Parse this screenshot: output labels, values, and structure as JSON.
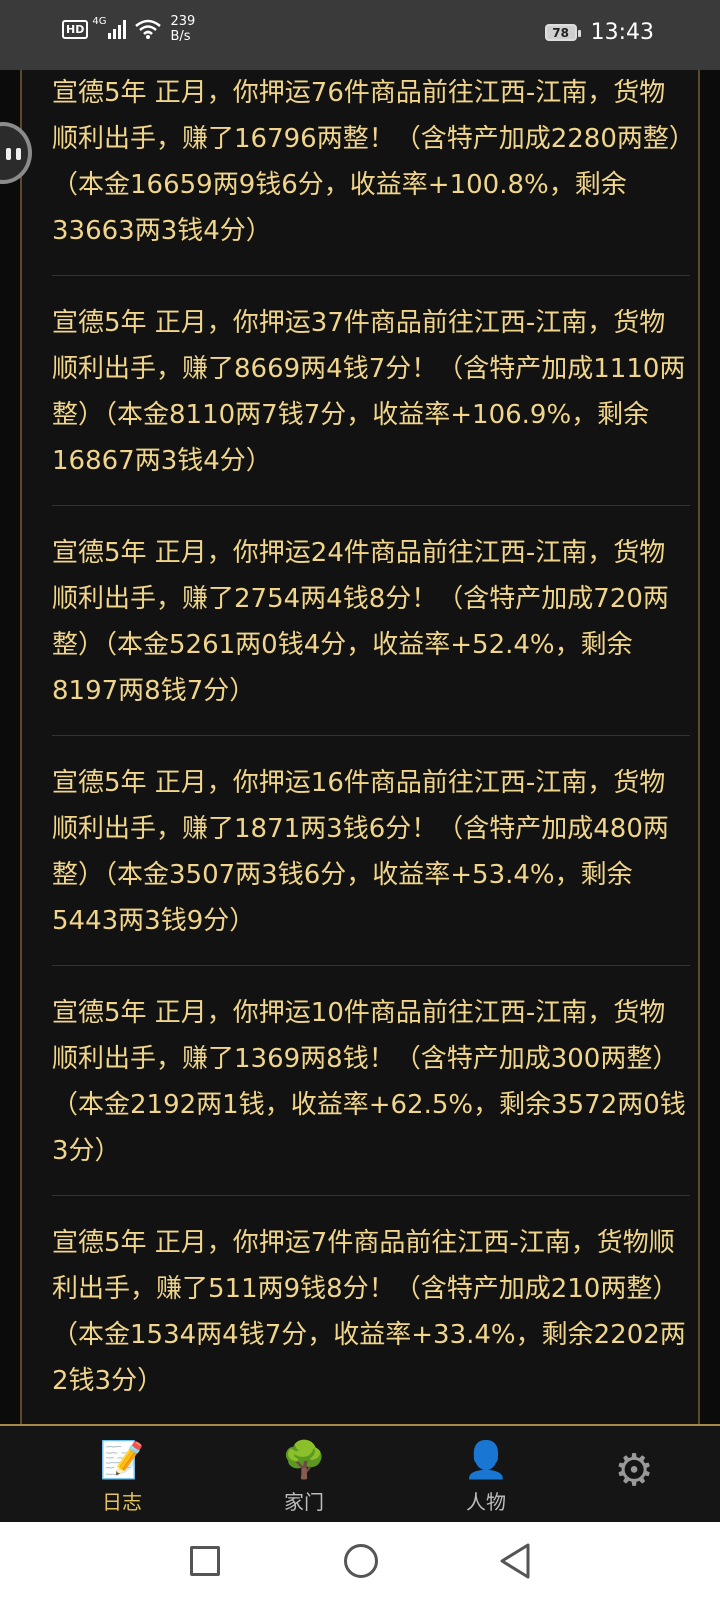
{
  "status_bar": {
    "hd": "HD",
    "network": "4G",
    "speed_value": "239",
    "speed_unit": "B/s",
    "battery": "78",
    "time": "13:43"
  },
  "log_entries": [
    "宣德5年 正月，你押运76件商品前往江西-江南，货物顺利出手，赚了16796两整！（含特产加成2280两整）（本金16659两9钱6分，收益率+100.8%，剩余33663两3钱4分）",
    "宣德5年 正月，你押运37件商品前往江西-江南，货物顺利出手，赚了8669两4钱7分！（含特产加成1110两整）（本金8110两7钱7分，收益率+106.9%，剩余16867两3钱4分）",
    "宣德5年 正月，你押运24件商品前往江西-江南，货物顺利出手，赚了2754两4钱8分！（含特产加成720两整）（本金5261两0钱4分，收益率+52.4%，剩余8197两8钱7分）",
    "宣德5年 正月，你押运16件商品前往江西-江南，货物顺利出手，赚了1871两3钱6分！（含特产加成480两整）（本金3507两3钱6分，收益率+53.4%，剩余5443两3钱9分）",
    "宣德5年 正月，你押运10件商品前往江西-江南，货物顺利出手，赚了1369两8钱！（含特产加成300两整）（本金2192两1钱，收益率+62.5%，剩余3572两0钱3分）",
    "宣德5年 正月，你押运7件商品前往江西-江南，货物顺利出手，赚了511两9钱8分！（含特产加成210两整）（本金1534两4钱7分，收益率+33.4%，剩余2202两2钱3分）"
  ],
  "bottom_nav": {
    "log_label": "日志",
    "family_label": "家门",
    "person_label": "人物",
    "log_icon": "📝",
    "family_icon": "🌳",
    "person_icon": "👤",
    "settings_icon": "⚙"
  },
  "colors": {
    "text_gold": "#f0d58a",
    "active_tab": "#e6c35f",
    "border_gold": "#a6894b"
  }
}
